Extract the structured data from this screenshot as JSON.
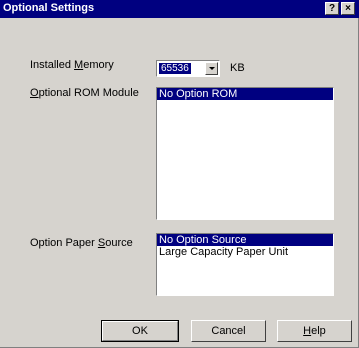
{
  "window": {
    "title": "Optional Settings",
    "help_glyph": "?",
    "close_glyph": "×"
  },
  "memory": {
    "label_pre": "Installed ",
    "label_accel": "M",
    "label_post": "emory",
    "value": "65536",
    "unit": "KB"
  },
  "rom": {
    "label_accel": "O",
    "label_post": "ptional ROM Module",
    "items": [
      "No Option ROM"
    ],
    "selected_index": 0
  },
  "paper_source": {
    "label_pre": "Option Paper ",
    "label_accel": "S",
    "label_post": "ource",
    "items": [
      "No Option Source",
      "Large Capacity Paper Unit"
    ],
    "selected_index": 0
  },
  "buttons": {
    "ok": "OK",
    "cancel": "Cancel",
    "help_accel": "H",
    "help_post": "elp"
  }
}
